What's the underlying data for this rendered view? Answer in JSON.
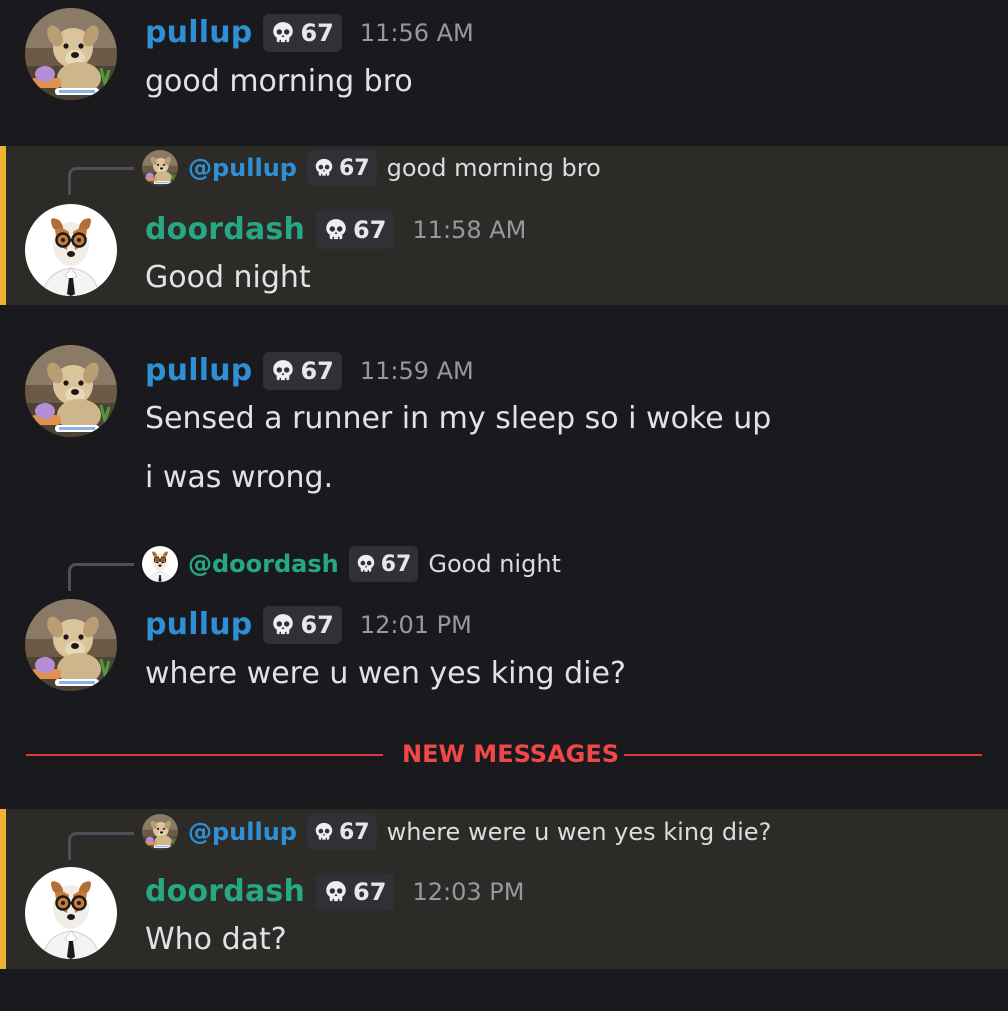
{
  "colors": {
    "background": "#1a1a1e",
    "highlight_background": "#2d2b27",
    "highlight_bar": "#f0b232",
    "username_pullup": "#2f8fd4",
    "username_doordash": "#25a884",
    "new_messages": "#f04747"
  },
  "messages": [
    {
      "username": "pullup",
      "tag": "67",
      "tag_icon": "skull-icon",
      "time": "11:56 AM",
      "lines": [
        "good morning bro"
      ]
    },
    {
      "reply": {
        "username": "@pullup",
        "tag": "67",
        "text": "good morning bro"
      },
      "username": "doordash",
      "tag": "67",
      "tag_icon": "skull-icon",
      "time": "11:58 AM",
      "lines": [
        "Good night"
      ]
    },
    {
      "username": "pullup",
      "tag": "67",
      "tag_icon": "skull-icon",
      "time": "11:59 AM",
      "lines": [
        "Sensed a runner in my sleep so i woke up",
        "i was wrong."
      ]
    },
    {
      "reply": {
        "username": "@doordash",
        "tag": "67",
        "text": "Good night"
      },
      "username": "pullup",
      "tag": "67",
      "tag_icon": "skull-icon",
      "time": "12:01 PM",
      "lines": [
        "where were u wen yes king die?"
      ]
    },
    {
      "reply": {
        "username": "@pullup",
        "tag": "67",
        "text": "where were u wen yes king die?"
      },
      "username": "doordash",
      "tag": "67",
      "tag_icon": "skull-icon",
      "time": "12:03 PM",
      "lines": [
        "Who dat?"
      ]
    }
  ],
  "divider": {
    "label": "NEW MESSAGES"
  }
}
